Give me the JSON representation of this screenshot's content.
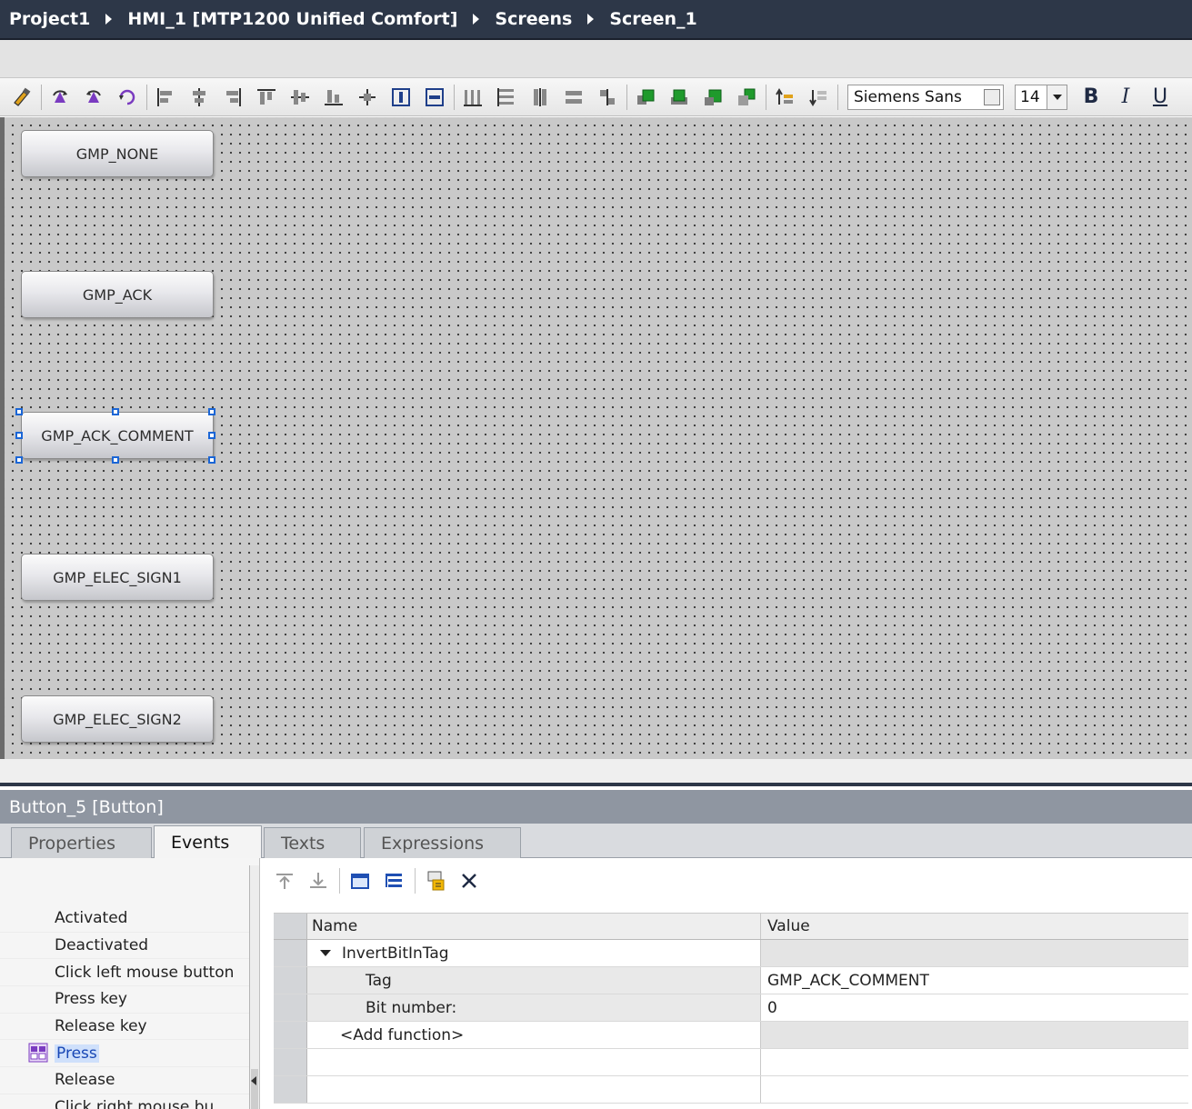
{
  "breadcrumb": [
    "Project1",
    "HMI_1 [MTP1200 Unified Comfort]",
    "Screens",
    "Screen_1"
  ],
  "toolbar": {
    "font_family": "Siemens Sans",
    "font_size": "14",
    "bold_label": "B",
    "italic_label": "I",
    "underline_label": "U"
  },
  "screen_buttons": [
    "GMP_NONE",
    "GMP_ACK",
    "GMP_ACK_COMMENT",
    "GMP_ELEC_SIGN1",
    "GMP_ELEC_SIGN2"
  ],
  "inspector": {
    "title": "Button_5 [Button]",
    "tabs": [
      "Properties",
      "Events",
      "Texts",
      "Expressions"
    ],
    "active_tab": "Events",
    "events": [
      "Activated",
      "Deactivated",
      "Click left mouse button",
      "Press key",
      "Release key",
      "Press",
      "Release",
      "Click right mouse bu"
    ],
    "selected_event": "Press",
    "grid": {
      "headers": {
        "name": "Name",
        "value": "Value"
      },
      "function_name": "InvertBitInTag",
      "params": [
        {
          "name": "Tag",
          "value": "GMP_ACK_COMMENT"
        },
        {
          "name": "Bit number:",
          "value": "0"
        }
      ],
      "add_function": "<Add function>"
    }
  },
  "colors": {
    "title_bar": "#2d3748",
    "canvas": "#c9c9c9",
    "selection": "#1b66d6",
    "inspector_title": "#8f96a1"
  }
}
